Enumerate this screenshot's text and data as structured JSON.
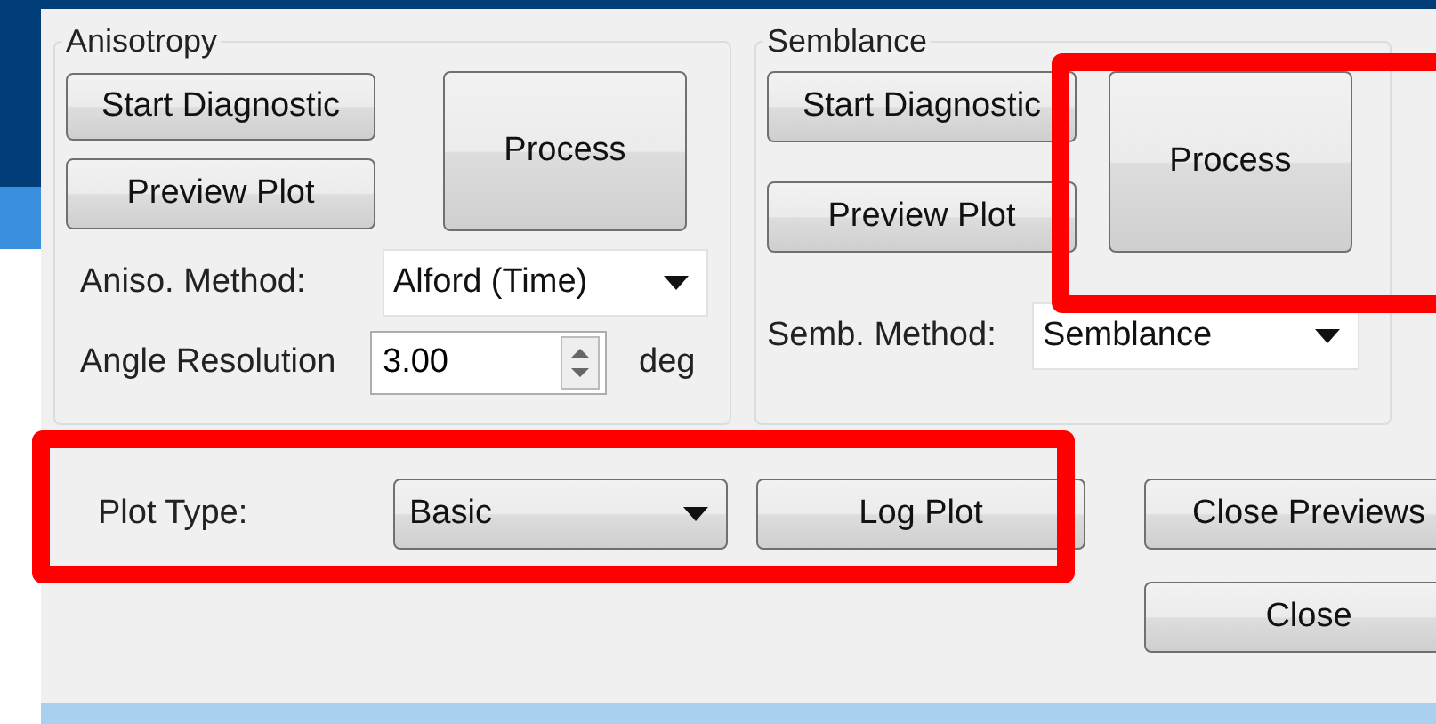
{
  "anisotropy": {
    "title": "Anisotropy",
    "start_button": "Start Diagnostic",
    "preview_button": "Preview Plot",
    "process_button": "Process",
    "method_label": "Aniso. Method:",
    "method": "Alford (Time)",
    "resolution_label": "Angle Resolution",
    "resolution": "3.00",
    "unit": "deg"
  },
  "semblance": {
    "title": "Semblance",
    "start_button": "Start Diagnostic",
    "preview_button": "Preview Plot",
    "process_button": "Process",
    "method_label": "Semb. Method:",
    "method": "Semblance"
  },
  "plot_type": {
    "label": "Plot Type:",
    "value": "Basic"
  },
  "buttons": [
    "Log Plot",
    "Close Previews",
    "Close"
  ],
  "highlights": [
    {
      "kind": "box"
    },
    {
      "kind": "box"
    }
  ]
}
